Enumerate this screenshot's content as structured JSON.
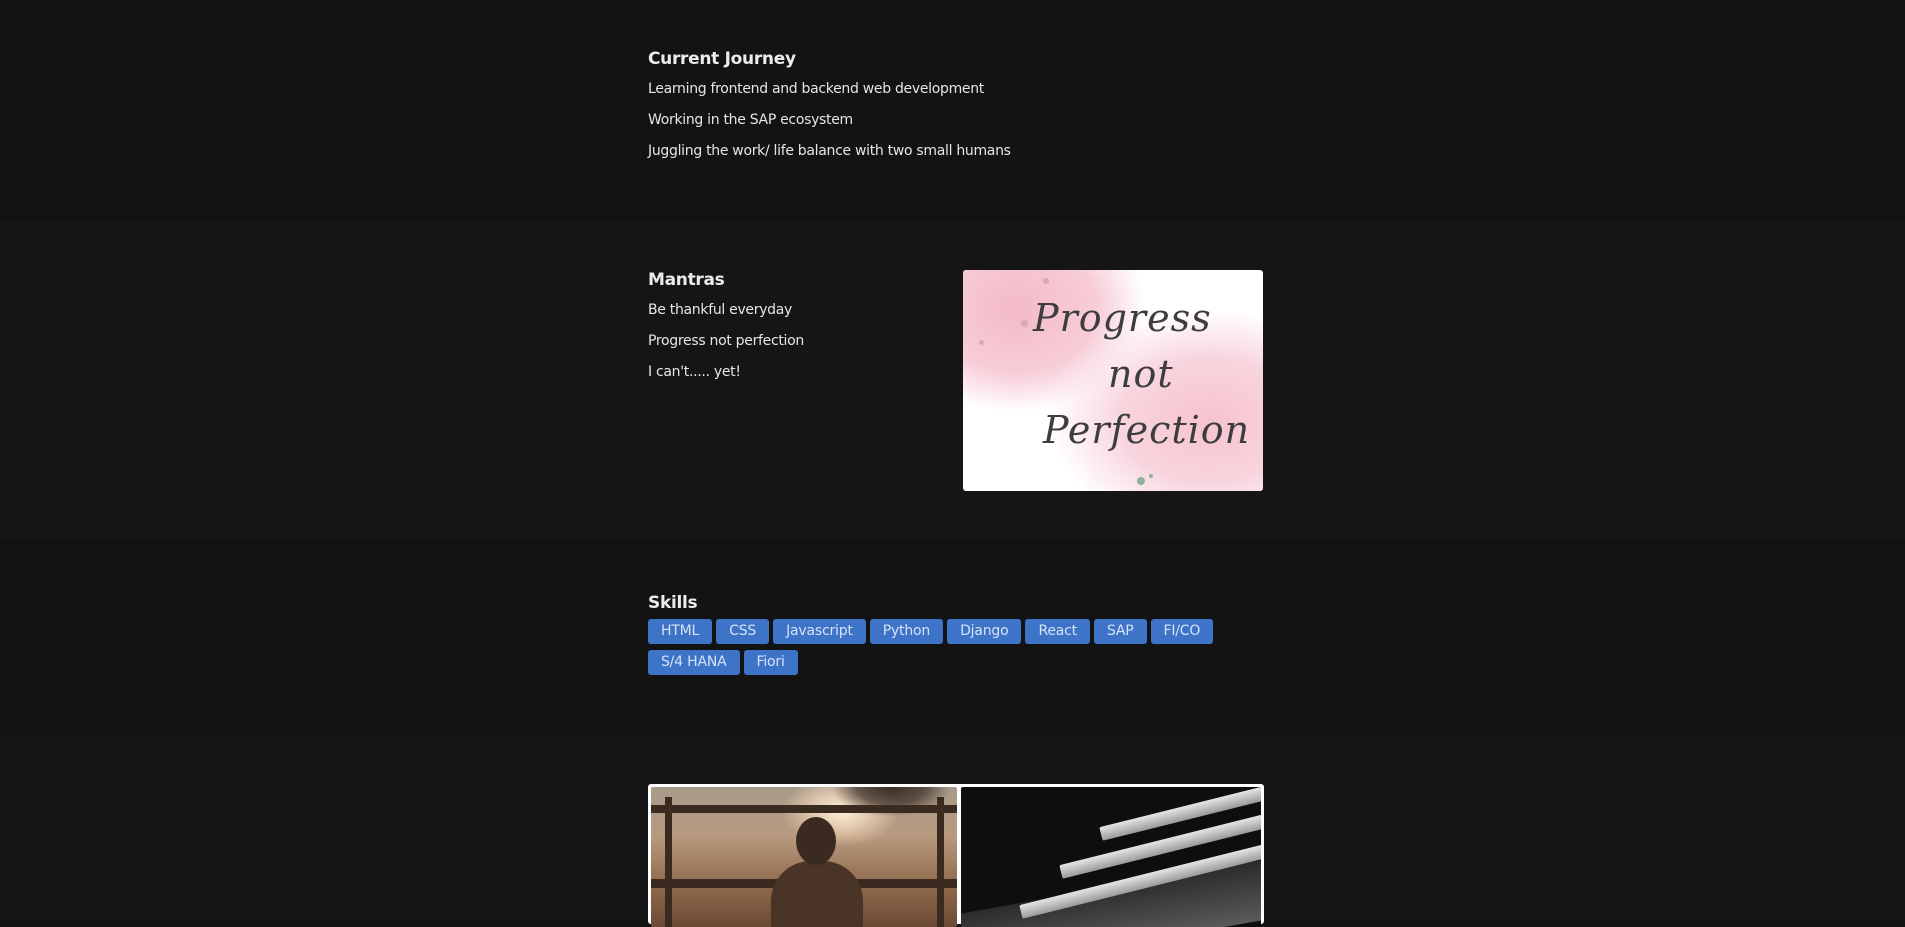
{
  "current_journey": {
    "title": "Current Journey",
    "items": [
      "Learning frontend and backend web development",
      "Working in the SAP ecosystem",
      "Juggling the work/ life balance with two small humans"
    ]
  },
  "mantras": {
    "title": "Mantras",
    "items": [
      "Be thankful everyday",
      "Progress not perfection",
      "I can't..... yet!"
    ],
    "image_text": [
      "Progress",
      "not",
      "Perfection"
    ]
  },
  "skills": {
    "title": "Skills",
    "tags": [
      "HTML",
      "CSS",
      "Javascript",
      "Python",
      "Django",
      "React",
      "SAP",
      "FI/CO",
      "S/4 HANA",
      "Fiori"
    ]
  },
  "colors": {
    "background": "#131313",
    "tag_background": "#3d74c8",
    "text": "#e9e9e9"
  }
}
